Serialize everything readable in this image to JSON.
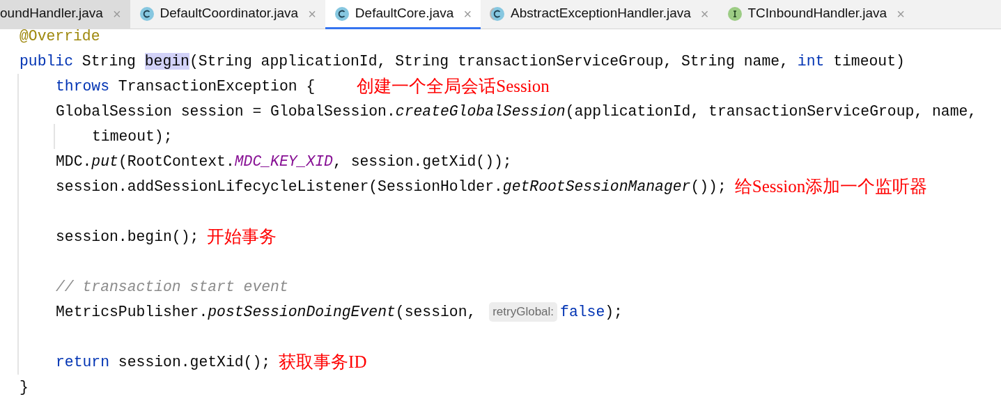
{
  "tabs": [
    {
      "label": "oundHandler.java",
      "kind": "plain",
      "close": "×",
      "selected": false,
      "hovered": true
    },
    {
      "label": "DefaultCoordinator.java",
      "kind": "class",
      "close": "×",
      "selected": false,
      "hovered": false
    },
    {
      "label": "DefaultCore.java",
      "kind": "class",
      "close": "×",
      "selected": true,
      "hovered": false
    },
    {
      "label": "AbstractExceptionHandler.java",
      "kind": "abstract",
      "close": "×",
      "selected": false,
      "hovered": false
    },
    {
      "label": "TCInboundHandler.java",
      "kind": "interface",
      "close": "×",
      "selected": false,
      "hovered": false
    }
  ],
  "code": [
    {
      "tokens": [
        {
          "text": "@Override",
          "kind": "annotation"
        }
      ]
    },
    {
      "tokens": [
        {
          "text": "public",
          "kind": "keyword"
        },
        {
          "text": " String ",
          "kind": "plain"
        },
        {
          "text": "begin",
          "kind": "highlight"
        },
        {
          "text": "(String applicationId, String transactionServiceGroup, String name, ",
          "kind": "plain"
        },
        {
          "text": "int",
          "kind": "keyword"
        },
        {
          "text": " timeout)",
          "kind": "plain"
        }
      ],
      "children": [
        {
          "tokens": [
            {
              "text": "throws",
              "kind": "keyword"
            },
            {
              "text": " TransactionException {",
              "kind": "plain"
            }
          ],
          "note": "创建一个全局会话Session"
        },
        {
          "tokens": [
            {
              "text": "GlobalSession session = GlobalSession.",
              "kind": "plain"
            },
            {
              "text": "createGlobalSession",
              "kind": "static-method"
            },
            {
              "text": "(applicationId, transactionServiceGroup, name,",
              "kind": "plain"
            }
          ],
          "children": [
            {
              "tokens": [
                {
                  "text": "timeout);",
                  "kind": "plain"
                }
              ]
            }
          ]
        },
        {
          "tokens": [
            {
              "text": "MDC.",
              "kind": "plain"
            },
            {
              "text": "put",
              "kind": "static-method"
            },
            {
              "text": "(RootContext.",
              "kind": "plain"
            },
            {
              "text": "MDC_KEY_XID",
              "kind": "constant"
            },
            {
              "text": ", session.getXid());",
              "kind": "plain"
            }
          ]
        },
        {
          "tokens": [
            {
              "text": "session.addSessionLifecycleListener(SessionHolder.",
              "kind": "plain"
            },
            {
              "text": "getRootSessionManager",
              "kind": "static-method"
            },
            {
              "text": "());",
              "kind": "plain"
            }
          ],
          "note": "给Session添加一个监听器"
        },
        {
          "blank_before": true,
          "tokens": [
            {
              "text": "session.begin();",
              "kind": "plain"
            }
          ],
          "note": "开始事务"
        },
        {
          "blank_before": true,
          "tokens": [
            {
              "text": "// transaction start event",
              "kind": "comment"
            }
          ]
        },
        {
          "tokens": [
            {
              "text": "MetricsPublisher.",
              "kind": "plain"
            },
            {
              "text": "postSessionDoingEvent",
              "kind": "static-method"
            },
            {
              "text": "(session, ",
              "kind": "plain"
            },
            {
              "text": "retryGlobal:",
              "kind": "hint"
            },
            {
              "text": "false",
              "kind": "keyword"
            },
            {
              "text": ");",
              "kind": "plain"
            }
          ]
        },
        {
          "blank_before": true,
          "tokens": [
            {
              "text": "return",
              "kind": "keyword"
            },
            {
              "text": " session.getXid();",
              "kind": "plain"
            }
          ],
          "note": "获取事务ID"
        }
      ]
    },
    {
      "tokens": [
        {
          "text": "}",
          "kind": "plain"
        }
      ]
    }
  ]
}
